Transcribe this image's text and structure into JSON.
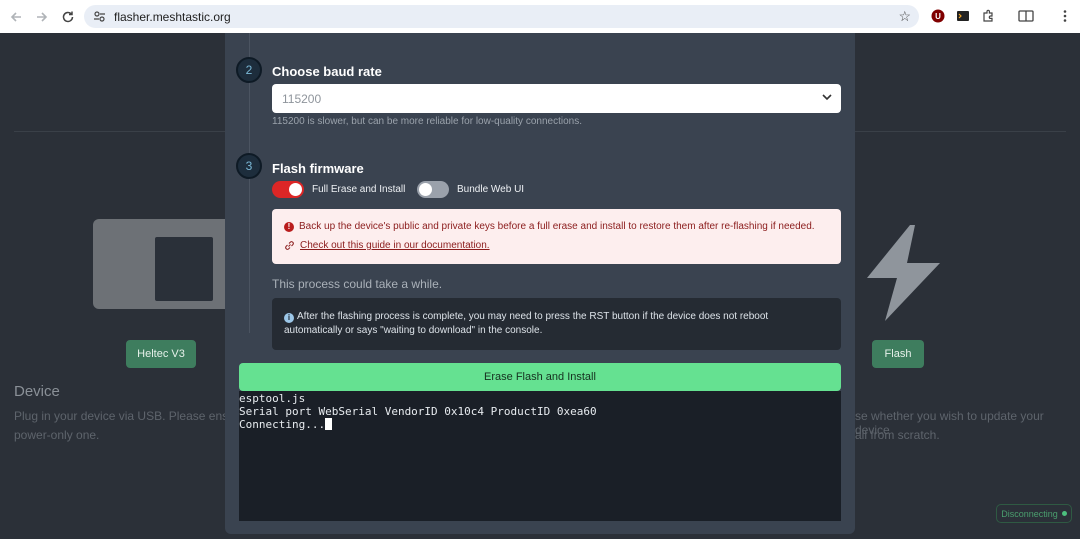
{
  "browser": {
    "url": "flasher.meshtastic.org"
  },
  "background": {
    "device_title": "Device",
    "device_text_1": "Plug in your device via USB. Please ensur",
    "device_text_2": "power-only one.",
    "right_text_1": "se whether you wish to update your device",
    "right_text_2": "all from scratch.",
    "device_button": "Heltec V3",
    "flash_button": "Flash",
    "status": "Disconnecting"
  },
  "modal": {
    "step2": {
      "number": "2",
      "title": "Choose baud rate",
      "selected_value": "115200",
      "hint": "115200 is slower, but can be more reliable for low-quality connections."
    },
    "step3": {
      "number": "3",
      "title": "Flash firmware",
      "toggle_full_erase_label": "Full Erase and Install",
      "toggle_full_erase_on": true,
      "toggle_bundle_label": "Bundle Web UI",
      "toggle_bundle_on": false,
      "warning_text": "Back up the device's public and private keys before a full erase and install to restore them after re-flashing if needed.",
      "warning_link": "Check out this guide in our documentation.",
      "process_text": "This process could take a while.",
      "info_text": "After the flashing process is complete, you may need to press the RST button if the device does not reboot automatically or says \"waiting to download\" in the console."
    },
    "install_button": "Erase Flash and Install",
    "console_lines": [
      "esptool.js",
      "Serial port WebSerial VendorID 0x10c4 ProductID 0xea60",
      "Connecting..."
    ]
  },
  "colors": {
    "accent_green": "#65e191",
    "danger_red": "#dc2626"
  }
}
